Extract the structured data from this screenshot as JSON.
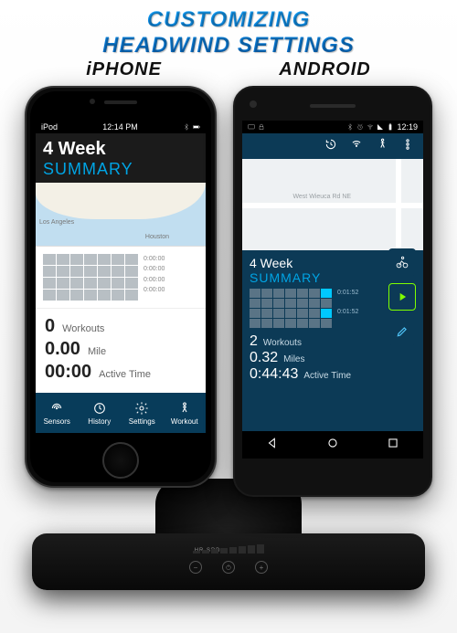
{
  "headline": {
    "line1": "CUSTOMIZING",
    "line2": "HEADWIND SETTINGS"
  },
  "platforms": {
    "left": "iPHONE",
    "right": "ANDROID"
  },
  "iphone": {
    "status": {
      "carrier": "iPod",
      "wifi": "wifi-icon",
      "time": "12:14 PM",
      "bt": "bt-icon",
      "batt": "batt-icon"
    },
    "summary": {
      "title_line1": "4 Week",
      "title_line2": "SUMMARY"
    },
    "map": {
      "city1": "Los Angeles",
      "city2": "Houston"
    },
    "grid_values": [
      "0:00:00",
      "0:00:00",
      "0:00:00",
      "0:00:00"
    ],
    "stats": {
      "workouts_num": "0",
      "workouts_label": "Workouts",
      "dist_num": "0.00",
      "dist_label": "Mile",
      "time_num": "00:00",
      "time_label": "Active Time"
    },
    "tabs": {
      "sensors": "Sensors",
      "history": "History",
      "settings": "Settings",
      "workout": "Workout"
    }
  },
  "android": {
    "status": {
      "time": "12:19"
    },
    "map_road": "West Wieuca Rd NE",
    "summary": {
      "title_line1": "4 Week",
      "title_line2": "SUMMARY"
    },
    "grid_values": [
      "0:01:52",
      "0:01:52"
    ],
    "stats": {
      "workouts_num": "2",
      "workouts_label": "Workouts",
      "dist_num": "0.32",
      "dist_label": "Miles",
      "time_num": "0:44:43",
      "time_label": "Active Time"
    }
  },
  "headwind": {
    "mode_label": "HR   SPD"
  }
}
